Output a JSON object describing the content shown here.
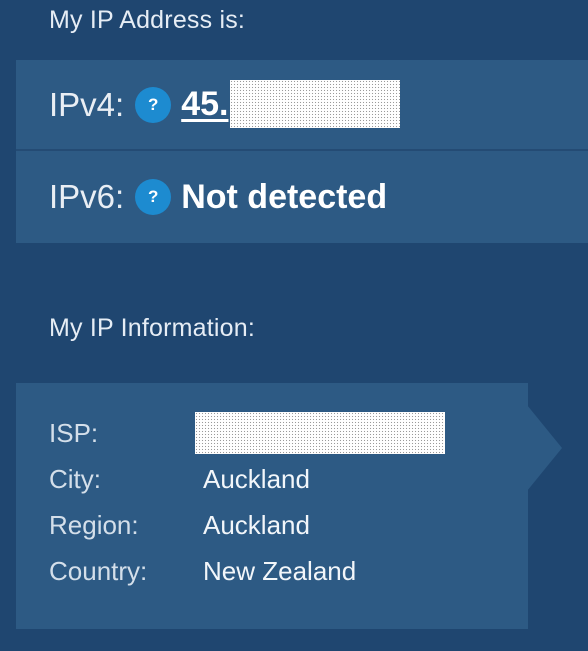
{
  "headings": {
    "address": "My IP Address is:",
    "info": "My IP Information:"
  },
  "ipv4": {
    "label": "IPv4:",
    "value": "45.",
    "help_icon": "question-mark-icon",
    "help_glyph": "?"
  },
  "ipv6": {
    "label": "IPv6:",
    "value": "Not detected",
    "help_icon": "question-mark-icon",
    "help_glyph": "?"
  },
  "info": {
    "rows": [
      {
        "key": "ISP:",
        "value": ""
      },
      {
        "key": "City:",
        "value": "Auckland"
      },
      {
        "key": "Region:",
        "value": "Auckland"
      },
      {
        "key": "Country:",
        "value": "New Zealand"
      }
    ]
  },
  "colors": {
    "background": "#1f4670",
    "panel": "#2d5a84",
    "help_icon": "#1d8bd0",
    "text": "#ffffff"
  }
}
